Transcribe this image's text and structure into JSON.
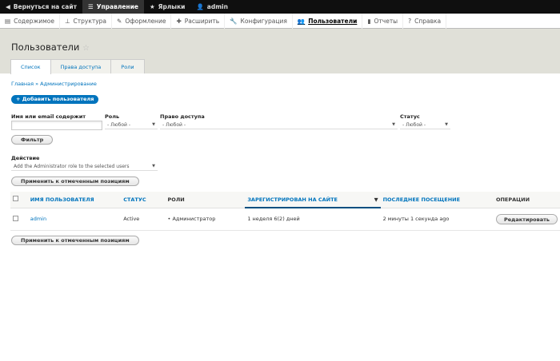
{
  "toolbar": {
    "back": "Вернуться на сайт",
    "manage": "Управление",
    "shortcuts": "Ярлыки",
    "user": "admin"
  },
  "tray": [
    "Содержимое",
    "Структура",
    "Оформление",
    "Расширить",
    "Конфигурация",
    "Пользователи",
    "Отчеты",
    "Справка"
  ],
  "page": {
    "title": "Пользователи",
    "tabs": [
      "Список",
      "Права доступа",
      "Роли"
    ],
    "breadcrumb": "Главная » Администрирование",
    "add_button": "+ Добавить пользователя"
  },
  "filters": {
    "name_label": "Имя или email содержит",
    "name_value": "",
    "role_label": "Роль",
    "role_value": "- Любой -",
    "perm_label": "Право доступа",
    "perm_value": "- Любой -",
    "status_label": "Статус",
    "status_value": "- Любой -",
    "filter_button": "Фильтр"
  },
  "action": {
    "label": "Действие",
    "value": "Add the Administrator role to the selected users",
    "apply": "Применить к отмеченным позициям"
  },
  "table": {
    "headers": [
      "ИМЯ ПОЛЬЗОВАТЕЛЯ",
      "СТАТУС",
      "РОЛИ",
      "ЗАРЕГИСТРИРОВАН НА САЙТЕ",
      "ПОСЛЕДНЕЕ ПОСЕЩЕНИЕ",
      "ОПЕРАЦИИ"
    ],
    "rows": [
      {
        "name": "admin",
        "status": "Active",
        "role": "Администратор",
        "registered": "1 неделя 6(2) дней",
        "last": "2 минуты 1 секунда ago",
        "op": "Редактировать"
      }
    ]
  }
}
